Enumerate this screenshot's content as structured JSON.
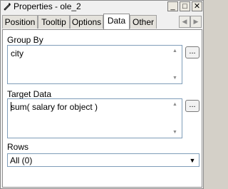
{
  "window": {
    "title": "Properties - ole_2",
    "buttons": {
      "minimize": "_",
      "maximize": "□",
      "close": "✕"
    }
  },
  "tabs": [
    {
      "label": "Position"
    },
    {
      "label": "Tooltip"
    },
    {
      "label": "Options"
    },
    {
      "label": "Data",
      "active": true
    },
    {
      "label": "Other"
    }
  ],
  "group_by": {
    "label": "Group By",
    "value": "city",
    "button": "..."
  },
  "target_data": {
    "label": "Target Data",
    "value": "sum(  salary for object )",
    "button": "..."
  },
  "rows": {
    "label": "Rows",
    "selected": "All (0)"
  },
  "colors": {
    "panel_bg": "#ffffff",
    "chrome_bg": "#f0f0f0",
    "field_border": "#7f9db9"
  }
}
